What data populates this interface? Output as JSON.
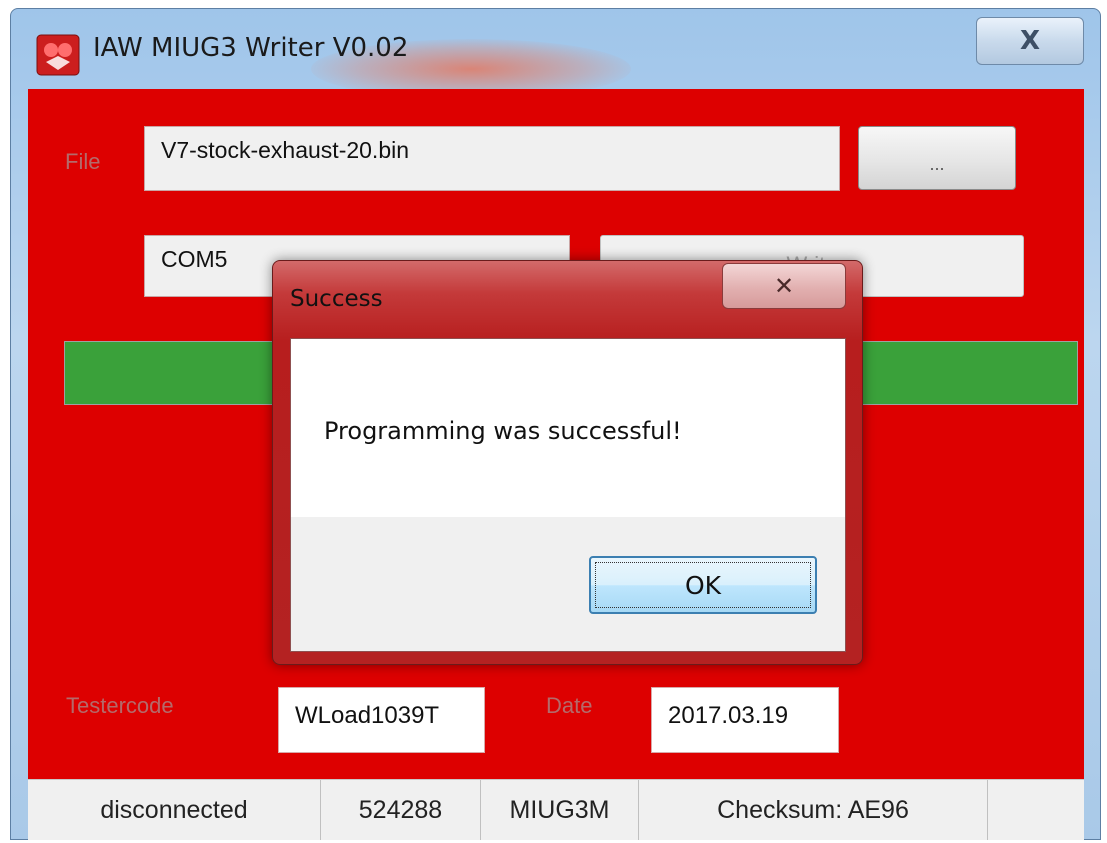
{
  "window": {
    "title": "IAW MIUG3 Writer V0.02",
    "close_label": "X"
  },
  "form": {
    "file_label": "File",
    "file_value": "V7-stock-exhaust-20.bin",
    "browse_label": "...",
    "port_value": "COM5",
    "write_label": "Write",
    "progress": 1.0,
    "testercode_label": "Testercode",
    "testercode_value": "WLoad1039T",
    "date_label": "Date",
    "date_value": "2017.03.19"
  },
  "statusbar": {
    "connection": "disconnected",
    "size": "524288",
    "device": "MIUG3M",
    "checksum": "Checksum: AE96"
  },
  "dialog": {
    "title": "Success",
    "close_label": "✕",
    "message": "Programming was successful!",
    "ok_label": "OK"
  }
}
